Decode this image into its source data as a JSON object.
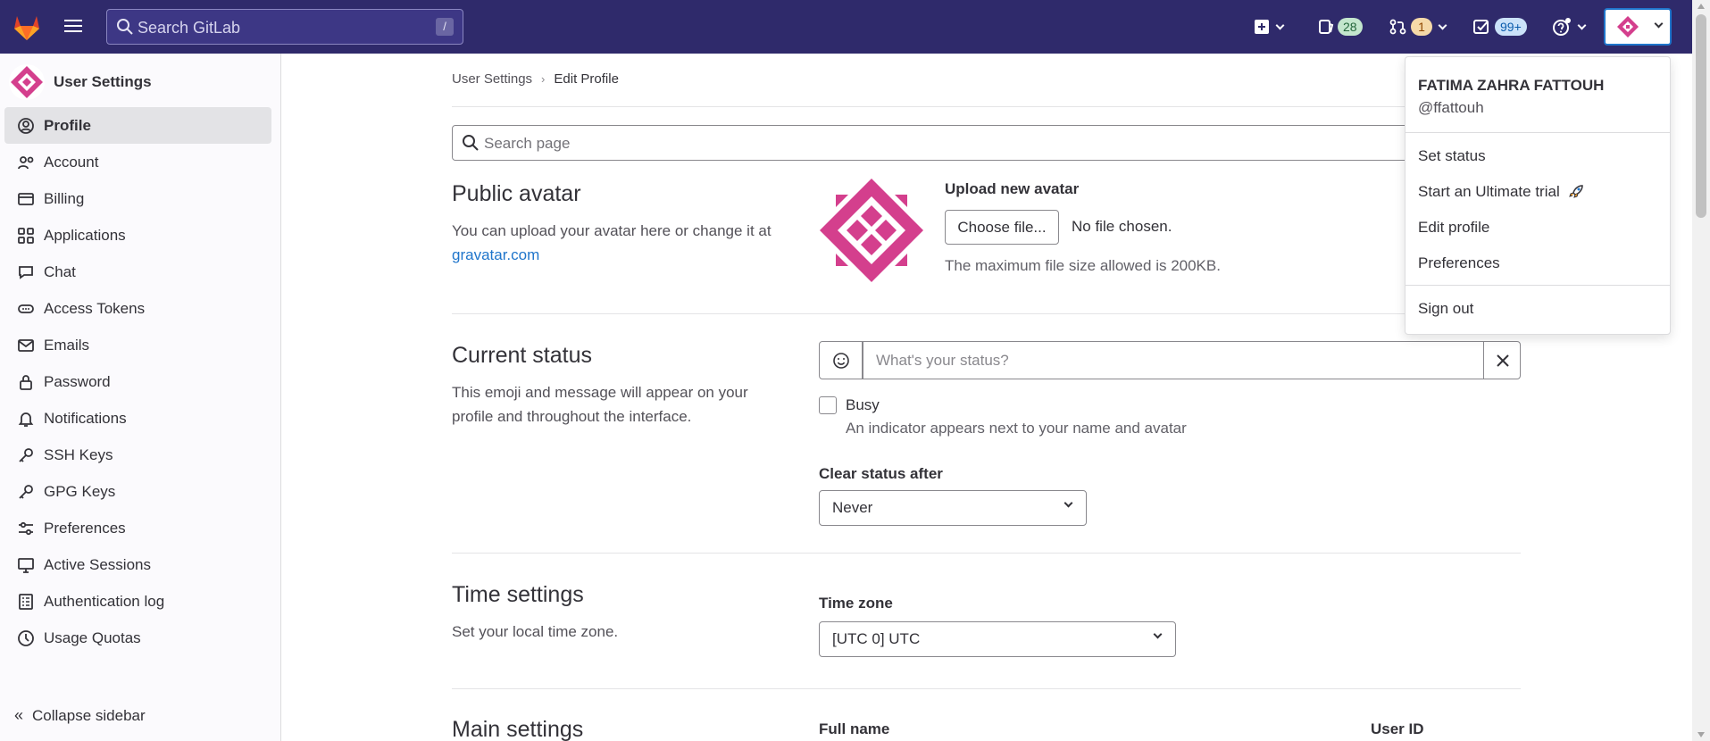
{
  "topbar": {
    "search_placeholder": "Search GitLab",
    "search_shortcut": "/",
    "issues_count": "28",
    "mr_count": "1",
    "todos_count": "99+"
  },
  "sidebar": {
    "title": "User Settings",
    "items": [
      {
        "label": "Profile",
        "icon": "user-icon",
        "active": true
      },
      {
        "label": "Account",
        "icon": "account-icon"
      },
      {
        "label": "Billing",
        "icon": "credit-card-icon"
      },
      {
        "label": "Applications",
        "icon": "applications-icon"
      },
      {
        "label": "Chat",
        "icon": "comment-icon"
      },
      {
        "label": "Access Tokens",
        "icon": "token-icon"
      },
      {
        "label": "Emails",
        "icon": "mail-icon"
      },
      {
        "label": "Password",
        "icon": "lock-icon"
      },
      {
        "label": "Notifications",
        "icon": "bell-icon"
      },
      {
        "label": "SSH Keys",
        "icon": "key-icon"
      },
      {
        "label": "GPG Keys",
        "icon": "key-icon"
      },
      {
        "label": "Preferences",
        "icon": "preferences-icon"
      },
      {
        "label": "Active Sessions",
        "icon": "monitor-icon"
      },
      {
        "label": "Authentication log",
        "icon": "log-icon"
      },
      {
        "label": "Usage Quotas",
        "icon": "quota-icon"
      }
    ],
    "collapse_label": "Collapse sidebar"
  },
  "breadcrumb": {
    "parent": "User Settings",
    "current": "Edit Profile"
  },
  "page_search_placeholder": "Search page",
  "avatar_section": {
    "title": "Public avatar",
    "desc": "You can upload your avatar here or change it at",
    "link": "gravatar.com",
    "upload_label": "Upload new avatar",
    "choose_button": "Choose file...",
    "no_file": "No file chosen.",
    "max_size": "The maximum file size allowed is 200KB."
  },
  "status_section": {
    "title": "Current status",
    "desc": "This emoji and message will appear on your profile and throughout the interface.",
    "placeholder": "What's your status?",
    "busy_label": "Busy",
    "busy_help": "An indicator appears next to your name and avatar",
    "clear_after_label": "Clear status after",
    "clear_after_value": "Never"
  },
  "time_section": {
    "title": "Time settings",
    "desc": "Set your local time zone.",
    "tz_label": "Time zone",
    "tz_value": "[UTC 0] UTC"
  },
  "main_section": {
    "title": "Main settings",
    "full_name_label": "Full name",
    "user_id_label": "User ID"
  },
  "dropdown": {
    "name": "FATIMA ZAHRA FATTOUH",
    "username": "@ffattouh",
    "set_status": "Set status",
    "trial": "Start an Ultimate trial",
    "edit_profile": "Edit profile",
    "preferences": "Preferences",
    "sign_out": "Sign out"
  },
  "colors": {
    "topbar": "#2f2a6b",
    "accent": "#1f75cb",
    "avatar": "#d43f8d"
  }
}
